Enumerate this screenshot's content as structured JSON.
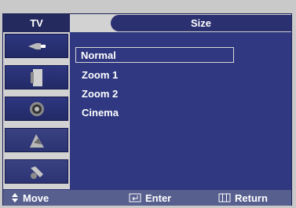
{
  "header": {
    "tv_label": "TV",
    "title": "Size"
  },
  "sidebar": {
    "items": [
      {
        "icon": "input-plug-icon"
      },
      {
        "icon": "picture-panel-icon"
      },
      {
        "icon": "sound-speaker-icon"
      },
      {
        "icon": "channel-dish-icon"
      },
      {
        "icon": "setup-tools-icon"
      }
    ]
  },
  "menu": {
    "options": [
      "Normal",
      "Zoom 1",
      "Zoom 2",
      "Cinema"
    ],
    "selected": "Normal"
  },
  "footer": {
    "move": "Move",
    "enter": "Enter",
    "return": "Return"
  }
}
